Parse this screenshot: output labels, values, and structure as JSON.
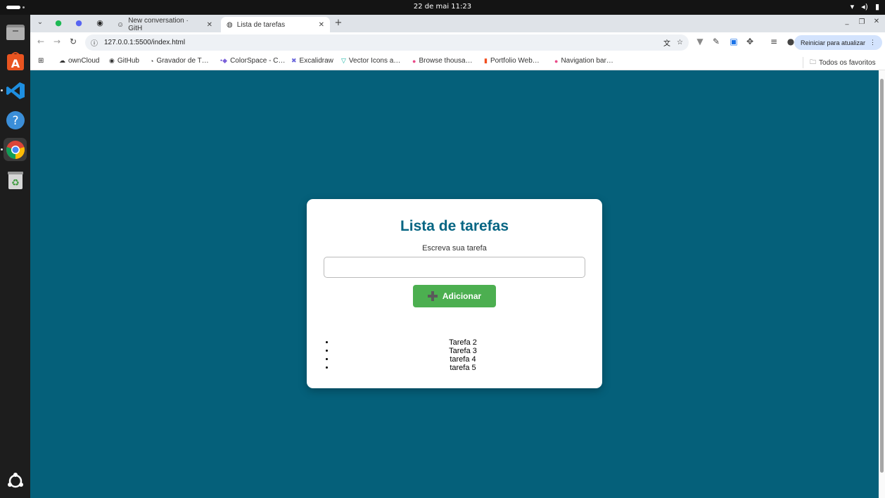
{
  "system": {
    "clock": "22 de mai  11:23"
  },
  "browser": {
    "tabs": [
      {
        "label": "New conversation · GitH",
        "active": false
      },
      {
        "label": "Lista de tarefas",
        "active": true
      }
    ],
    "address": "127.0.0.1:5500/index.html",
    "update_button": "Reiniciar para atualizar",
    "bookmarks": [
      "ownCloud",
      "GitHub",
      "Gravador de T…",
      "ColorSpace - C…",
      "Excalidraw",
      "Vector Icons a…",
      "Browse thousa…",
      "Portfolio Web…",
      "Navigation bar…"
    ],
    "all_bookmarks": "Todos os favoritos"
  },
  "app": {
    "title": "Lista de tarefas",
    "input_label": "Escreva sua tarefa",
    "input_value": "",
    "add_button": "Adicionar",
    "tasks": [
      "Tarefa 2",
      "Tarefa 3",
      "tarefa 4",
      "tarefa 5"
    ]
  },
  "colors": {
    "page_background": "#05607a",
    "title": "#066583",
    "add_button": "#4caf50"
  }
}
